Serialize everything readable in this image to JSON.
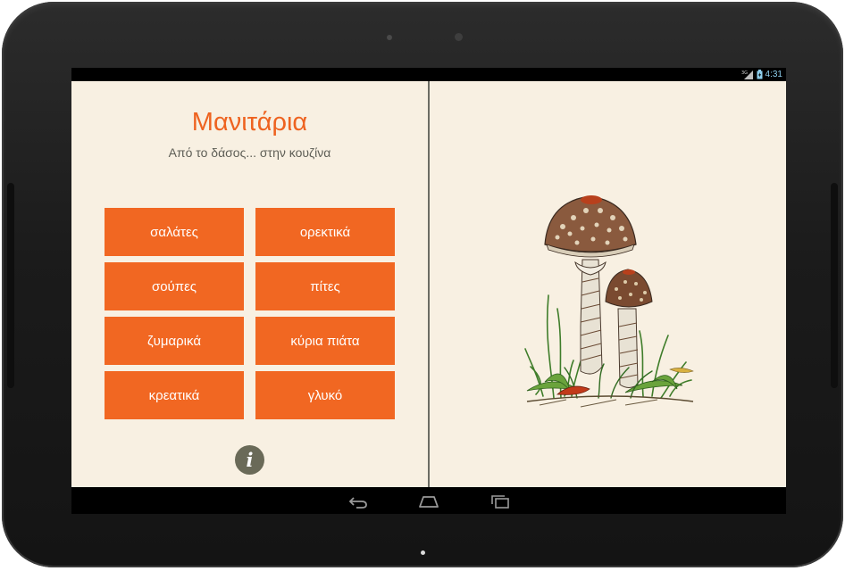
{
  "status_bar": {
    "signal_label": "3G",
    "time": "4:31"
  },
  "app": {
    "title": "Μανιτάρια",
    "subtitle": "Από το δάσος... στην κουζίνα",
    "menu": [
      {
        "label": "σαλάτες"
      },
      {
        "label": "ορεκτικά"
      },
      {
        "label": "σούπες"
      },
      {
        "label": "πίτες"
      },
      {
        "label": "ζυμαρικά"
      },
      {
        "label": "κύρια πιάτα"
      },
      {
        "label": "κρεατικά"
      },
      {
        "label": "γλυκό"
      }
    ],
    "info_glyph": "i",
    "accent_color": "#f16722",
    "background_color": "#f8f0e2"
  },
  "nav_bar": {
    "icons": [
      "back-icon",
      "home-icon",
      "recent-apps-icon"
    ]
  }
}
